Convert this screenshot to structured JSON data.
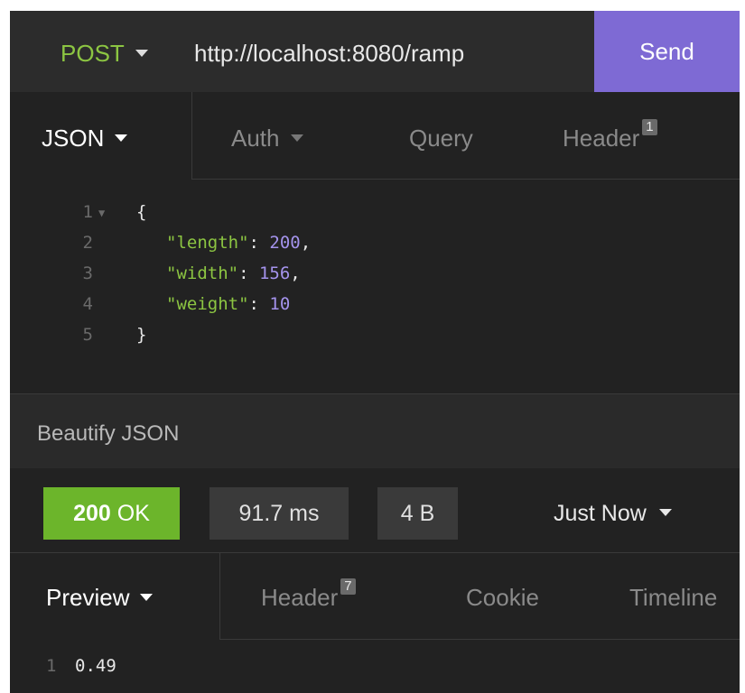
{
  "request": {
    "method": "POST",
    "url": "http://localhost:8080/ramp",
    "send_label": "Send"
  },
  "request_tabs": {
    "body": "JSON",
    "auth": "Auth",
    "query": "Query",
    "header": "Header",
    "header_count": "1"
  },
  "editor": {
    "lines": [
      {
        "n": "1",
        "text": "{"
      },
      {
        "n": "2",
        "key": "\"length\"",
        "value": "200",
        "tail": ","
      },
      {
        "n": "3",
        "key": "\"width\"",
        "value": "156",
        "tail": ","
      },
      {
        "n": "4",
        "key": "\"weight\"",
        "value": "10",
        "tail": ""
      },
      {
        "n": "5",
        "text": "}"
      }
    ]
  },
  "beautify_label": "Beautify JSON",
  "status": {
    "code": "200",
    "text": "OK",
    "time": "91.7 ms",
    "size": "4 B",
    "when": "Just Now"
  },
  "response_tabs": {
    "preview": "Preview",
    "header": "Header",
    "header_count": "7",
    "cookie": "Cookie",
    "timeline": "Timeline"
  },
  "response": {
    "line_number": "1",
    "value": "0.49"
  },
  "colors": {
    "send_bg": "#7e6ad4",
    "method": "#8cc542",
    "status_ok": "#6cb52b",
    "json_key": "#8cc542",
    "json_number": "#a493ec"
  }
}
